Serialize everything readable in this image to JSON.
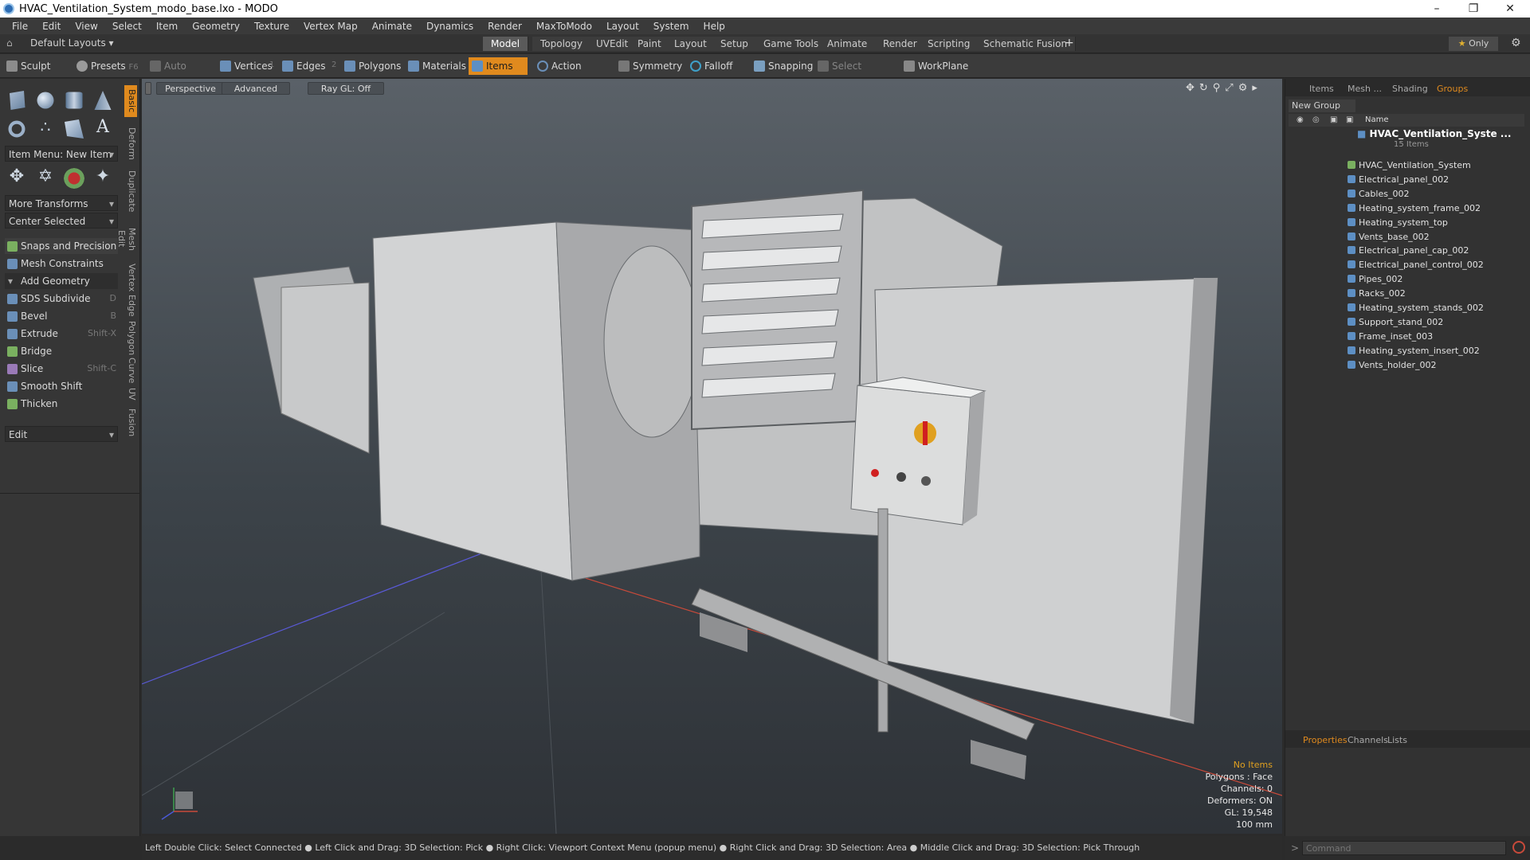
{
  "window": {
    "title": "HVAC_Ventilation_System_modo_base.lxo - MODO"
  },
  "menu": [
    "File",
    "Edit",
    "View",
    "Select",
    "Item",
    "Geometry",
    "Texture",
    "Vertex Map",
    "Animate",
    "Dynamics",
    "Render",
    "MaxToModo",
    "Layout",
    "System",
    "Help"
  ],
  "layouts": {
    "label": "Default Layouts"
  },
  "modes": [
    "Model",
    "Topology",
    "UVEdit",
    "Paint",
    "Layout",
    "Setup",
    "Game Tools",
    "Animate",
    "Render",
    "Scripting",
    "Schematic Fusion"
  ],
  "only": "Only",
  "toolbar": {
    "sculpt": "Sculpt",
    "presets": "Presets",
    "presets_key": "F6",
    "auto_select": "Auto Select",
    "vertices": "Vertices",
    "vertices_n": "1",
    "edges": "Edges",
    "edges_n": "2",
    "polygons": "Polygons",
    "materials": "Materials",
    "items": "Items",
    "action_center": "Action Center",
    "symmetry": "Symmetry",
    "falloff": "Falloff",
    "snapping": "Snapping",
    "select_through": "Select Through",
    "workplane": "WorkPlane"
  },
  "left": {
    "item_menu": "Item Menu: New Item",
    "more_transforms": "More Transforms",
    "center_selected": "Center Selected",
    "snaps": "Snaps and Precision",
    "mesh_constraints": "Mesh Constraints",
    "add_geometry": "Add Geometry",
    "tools": [
      {
        "label": "SDS Subdivide",
        "key": "D"
      },
      {
        "label": "Bevel",
        "key": "B"
      },
      {
        "label": "Extrude",
        "key": "Shift-X"
      },
      {
        "label": "Bridge",
        "key": ""
      },
      {
        "label": "Slice",
        "key": "Shift-C"
      },
      {
        "label": "Smooth Shift",
        "key": ""
      },
      {
        "label": "Thicken",
        "key": ""
      }
    ],
    "edit": "Edit",
    "vtabs": [
      "Basic",
      "Deform",
      "Duplicate",
      "Mesh Edit",
      "Vertex",
      "Edge",
      "Polygon",
      "Curve",
      "UV",
      "Fusion"
    ]
  },
  "viewport": {
    "perspective": "Perspective",
    "advanced": "Advanced",
    "raygl": "Ray GL: Off",
    "stats": [
      "No Items",
      "Polygons : Face",
      "Channels: 0",
      "Deformers: ON",
      "GL: 19,548",
      "100 mm"
    ]
  },
  "right": {
    "tabs": [
      "Items",
      "Mesh ...",
      "Shading",
      "Groups"
    ],
    "new_group": "New Group",
    "name_col": "Name",
    "group_name": "HVAC_Ventilation_Syste ...",
    "group_count": "15 Items",
    "items": [
      "HVAC_Ventilation_System",
      "Electrical_panel_002",
      "Cables_002",
      "Heating_system_frame_002",
      "Heating_system_top",
      "Vents_base_002",
      "Electrical_panel_cap_002",
      "Electrical_panel_control_002",
      "Pipes_002",
      "Racks_002",
      "Heating_system_stands_002",
      "Support_stand_002",
      "Frame_inset_003",
      "Heating_system_insert_002",
      "Vents_holder_002"
    ],
    "bottom_tabs": [
      "Properties",
      "Channels",
      "Lists"
    ]
  },
  "status": "Left Double Click: Select Connected ● Left Click and Drag: 3D Selection: Pick ● Right Click: Viewport Context Menu (popup menu) ● Right Click and Drag: 3D Selection: Area ● Middle Click and Drag: 3D Selection: Pick Through",
  "command": {
    "placeholder": "Command"
  },
  "colors": {
    "accent": "#e08a1e",
    "items_blue": "#5d8fc4"
  }
}
